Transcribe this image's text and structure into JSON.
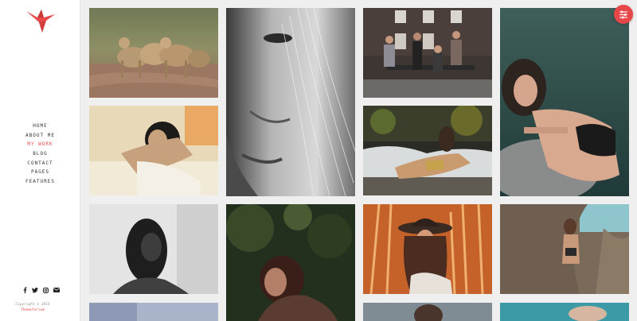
{
  "brand": {
    "logo_icon": "bird-icon",
    "accent_color": "#e84a4a"
  },
  "nav": {
    "items": [
      {
        "label": "HOME",
        "active": false
      },
      {
        "label": "ABOUT ME",
        "active": false
      },
      {
        "label": "MY WORK",
        "active": true
      },
      {
        "label": "BLOG",
        "active": false
      },
      {
        "label": "CONTACT",
        "active": false
      },
      {
        "label": "PAGES",
        "active": false
      },
      {
        "label": "FEATURES",
        "active": false
      }
    ]
  },
  "social": [
    "facebook-icon",
    "twitter-icon",
    "instagram-icon",
    "email-icon"
  ],
  "footer": {
    "copyright": "Copyright © 2016",
    "brand": "Themeforium"
  },
  "filter_button": {
    "icon": "sliders-icon",
    "color": "#e8474a"
  },
  "gallery": {
    "tiles": [
      {
        "name": "photo-lions",
        "subject": "lions"
      },
      {
        "name": "photo-woman-face-closeup",
        "subject": "woman-face-bw"
      },
      {
        "name": "photo-group-bench",
        "subject": "group-bench"
      },
      {
        "name": "photo-woman-rock-lingerie",
        "subject": "woman-rock"
      },
      {
        "name": "photo-woman-bed",
        "subject": "woman-bed"
      },
      {
        "name": "photo-woman-beach-waves",
        "subject": "woman-beach"
      },
      {
        "name": "photo-woman-bw-portrait",
        "subject": "woman-bw-portrait"
      },
      {
        "name": "photo-woman-forest",
        "subject": "woman-forest"
      },
      {
        "name": "photo-woman-hat-field",
        "subject": "woman-hat"
      },
      {
        "name": "photo-woman-rocks-sea",
        "subject": "woman-rocks"
      },
      {
        "name": "photo-row3-col1",
        "subject": "partial"
      },
      {
        "name": "photo-row3-col3",
        "subject": "partial"
      },
      {
        "name": "photo-row3-col4",
        "subject": "partial"
      }
    ]
  }
}
